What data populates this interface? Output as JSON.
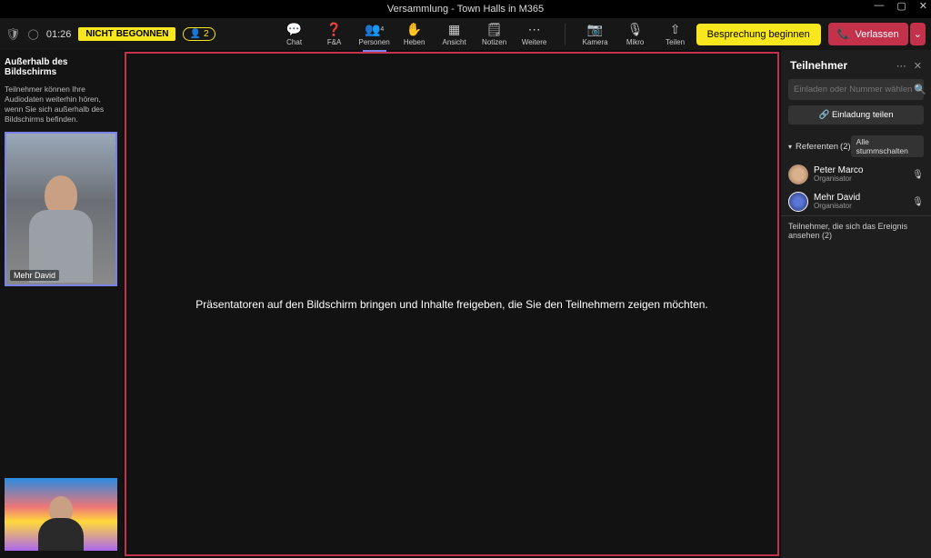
{
  "titlebar": {
    "title": "Versammlung - Town Halls in M365"
  },
  "topbar": {
    "timer": "01:26",
    "status": "NICHT BEGONNEN",
    "participant_count": "2",
    "toolbar": {
      "chat": "Chat",
      "qa": "F&A",
      "people": "Personen",
      "people_count": "4",
      "raise": "Heben",
      "view": "Ansicht",
      "notes": "Notizen",
      "more": "Weitere",
      "camera": "Kamera",
      "mic": "Mikro",
      "share": "Teilen"
    },
    "begin_button": "Besprechung beginnen",
    "leave_button": "Verlassen"
  },
  "left_panel": {
    "title": "Außerhalb des Bildschirms",
    "hint": "Teilnehmer können Ihre Audiodaten weiterhin hören, wenn Sie sich außerhalb des Bildschirms befinden.",
    "tile1_name": "Mehr David"
  },
  "center": {
    "message": "Präsentatoren auf den Bildschirm bringen und Inhalte freigeben, die Sie den Teilnehmern zeigen möchten."
  },
  "right_panel": {
    "title": "Teilnehmer",
    "search_placeholder": "Einladen oder Nummer wählen",
    "share_invite": "Einladung teilen",
    "section_label": "Referenten",
    "section_count": "(2)",
    "mute_all": "Alle stummschalten",
    "participants": [
      {
        "name": "Peter Marco",
        "role": "Organisator"
      },
      {
        "name": "Mehr David",
        "role": "Organisator"
      }
    ],
    "viewers_label": "Teilnehmer, die sich das Ereignis ansehen (2)"
  }
}
